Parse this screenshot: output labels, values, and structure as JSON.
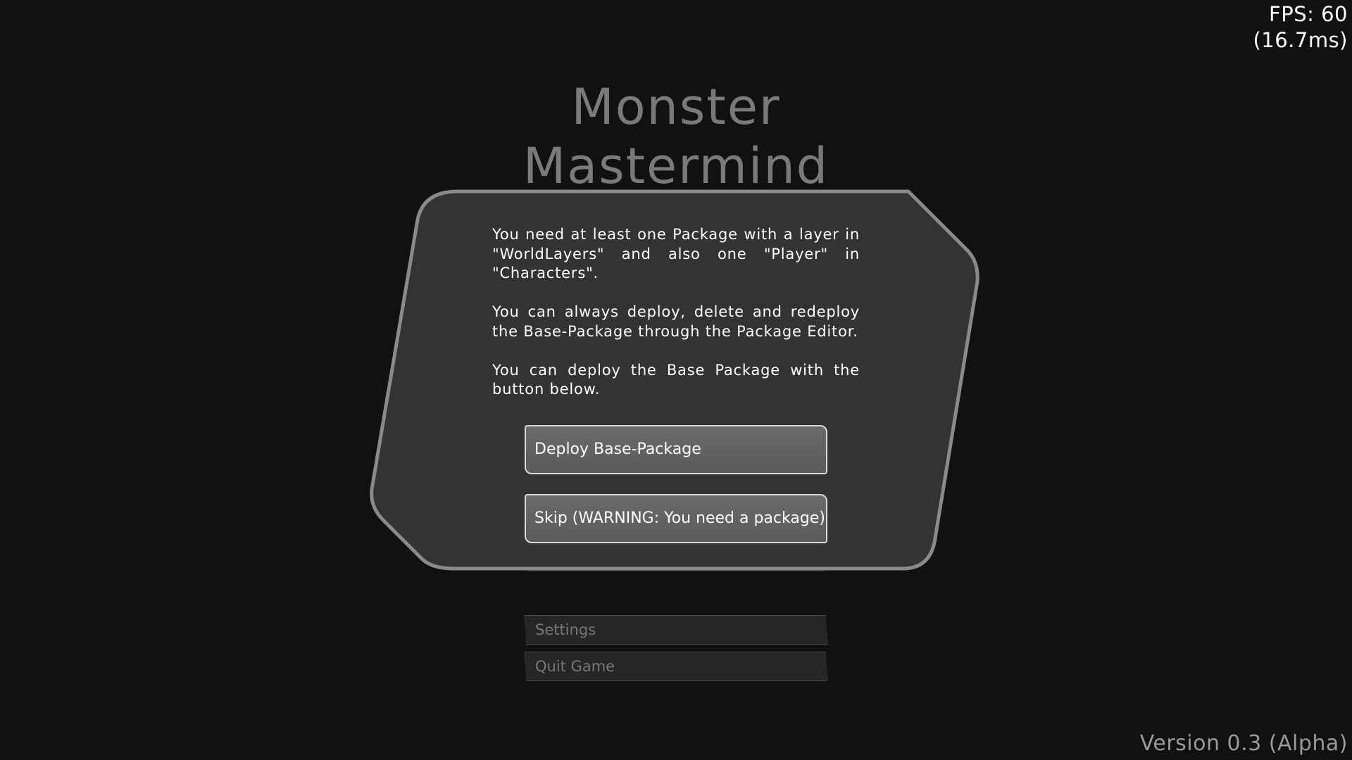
{
  "hud": {
    "fps_label": "FPS: 60",
    "frame_time": "(16.7ms)",
    "version": "Version 0.3 (Alpha)"
  },
  "title": {
    "line1": "Monster",
    "line2": "Mastermind"
  },
  "main_menu": {
    "settings_label": "Settings",
    "quit_label": "Quit Game"
  },
  "dialog": {
    "paragraphs": [
      "You need at least one Package with a layer in \"WorldLayers\" and also one \"Player\" in \"Characters\".",
      "You can always deploy, delete and redeploy the Base-Package through the Package Editor.",
      "You can deploy the Base Package with the button below."
    ],
    "deploy_label": "Deploy Base-Package",
    "skip_label": "Skip (WARNING: You need a package)"
  },
  "colors": {
    "background": "#111111",
    "dialog_fill": "#333333",
    "dialog_border": "#8a8a8a",
    "button_fill": "#636363",
    "button_border": "#d9d9d9",
    "title_text": "#7a7a7a"
  }
}
